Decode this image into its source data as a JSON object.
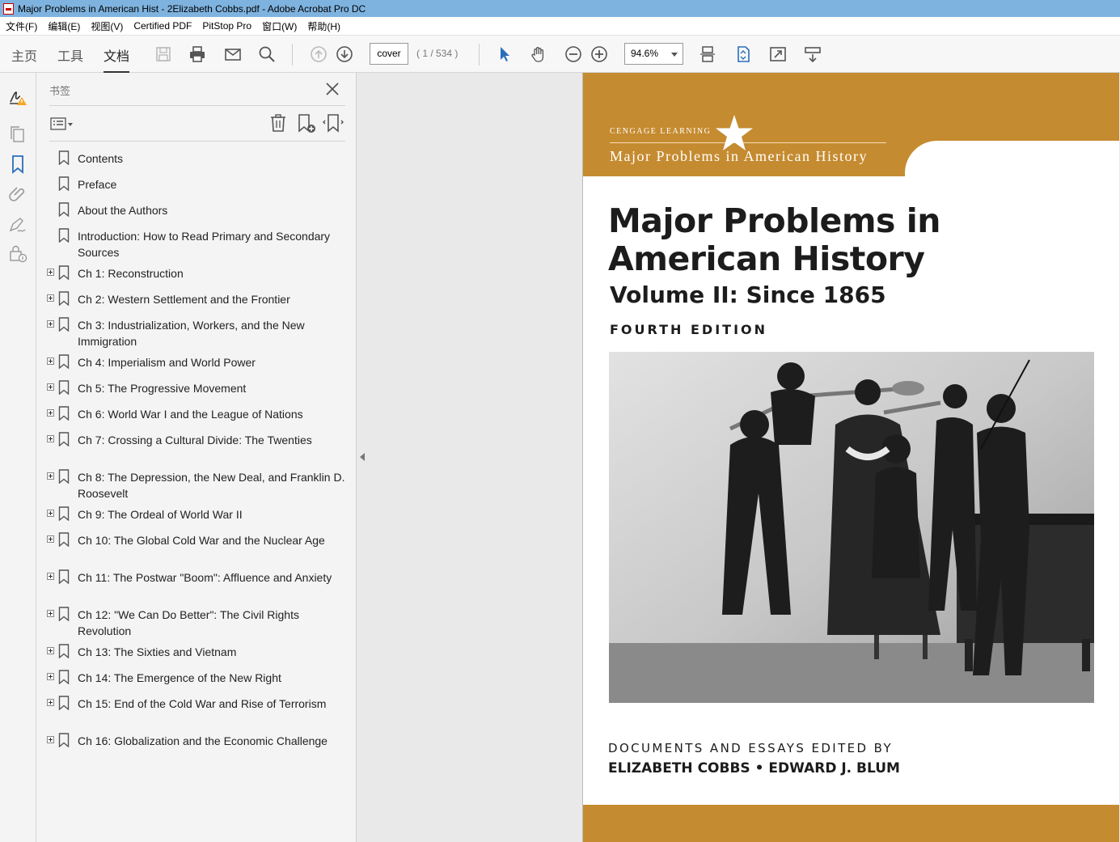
{
  "window": {
    "title": "Major Problems in American Hist - 2Elizabeth Cobbs.pdf - Adobe Acrobat Pro DC"
  },
  "menu": [
    "文件(F)",
    "编辑(E)",
    "视图(V)",
    "Certified PDF",
    "PitStop Pro",
    "窗口(W)",
    "帮助(H)"
  ],
  "tabs": {
    "home": "主页",
    "tools": "工具",
    "document": "文档"
  },
  "nav": {
    "page_value": "cover",
    "page_count": "( 1 / 534 )",
    "zoom": "94.6%"
  },
  "bookmarks_panel": {
    "title": "书签",
    "items": [
      {
        "label": "Contents",
        "expandable": false
      },
      {
        "label": "Preface",
        "expandable": false
      },
      {
        "label": "About the Authors",
        "expandable": false
      },
      {
        "label": "Introduction: How to Read Primary and Secondary Sources",
        "expandable": false
      },
      {
        "label": "Ch 1: Reconstruction",
        "expandable": true
      },
      {
        "label": "Ch 2: Western Settlement and the Frontier",
        "expandable": true
      },
      {
        "label": "Ch 3: Industrialization, Workers, and the New Immigration",
        "expandable": true
      },
      {
        "label": "Ch 4: Imperialism and World Power",
        "expandable": true
      },
      {
        "label": "Ch 5: The Progressive Movement",
        "expandable": true
      },
      {
        "label": "Ch 6: World War I and the League of Nations",
        "expandable": true
      },
      {
        "label": "Ch 7: Crossing a Cultural Divide: The Twenties",
        "expandable": true
      },
      {
        "label": "Ch 8: The Depression, the New Deal, and Franklin D. Roosevelt",
        "expandable": true
      },
      {
        "label": "Ch 9: The Ordeal of World War II",
        "expandable": true
      },
      {
        "label": "Ch 10: The Global Cold War and the Nuclear Age",
        "expandable": true
      },
      {
        "label": "Ch 11: The Postwar \"Boom\": Affluence and Anxiety",
        "expandable": true
      },
      {
        "label": "Ch 12: \"We Can Do Better\": The Civil Rights Revolution",
        "expandable": true
      },
      {
        "label": "Ch 13: The Sixties and Vietnam",
        "expandable": true
      },
      {
        "label": "Ch 14: The Emergence of the New Right",
        "expandable": true
      },
      {
        "label": "Ch 15: End of the Cold War and Rise of Terrorism",
        "expandable": true
      },
      {
        "label": "Ch 16: Globalization and the Economic Challenge",
        "expandable": true
      }
    ]
  },
  "cover": {
    "publisher": "CENGAGE LEARNING",
    "series": "Major Problems in American History",
    "title_line1": "Major Problems in",
    "title_line2": "American History",
    "volume": "Volume II:  Since 1865",
    "edition": "FOURTH  EDITION",
    "documents": "DOCUMENTS AND ESSAYS EDITED BY",
    "authors": "ELIZABETH COBBS • EDWARD J. BLUM"
  },
  "colors": {
    "accent_band": "#c58b30",
    "titlebar": "#7fb3df",
    "bookmark_active": "#2a6ebb"
  }
}
